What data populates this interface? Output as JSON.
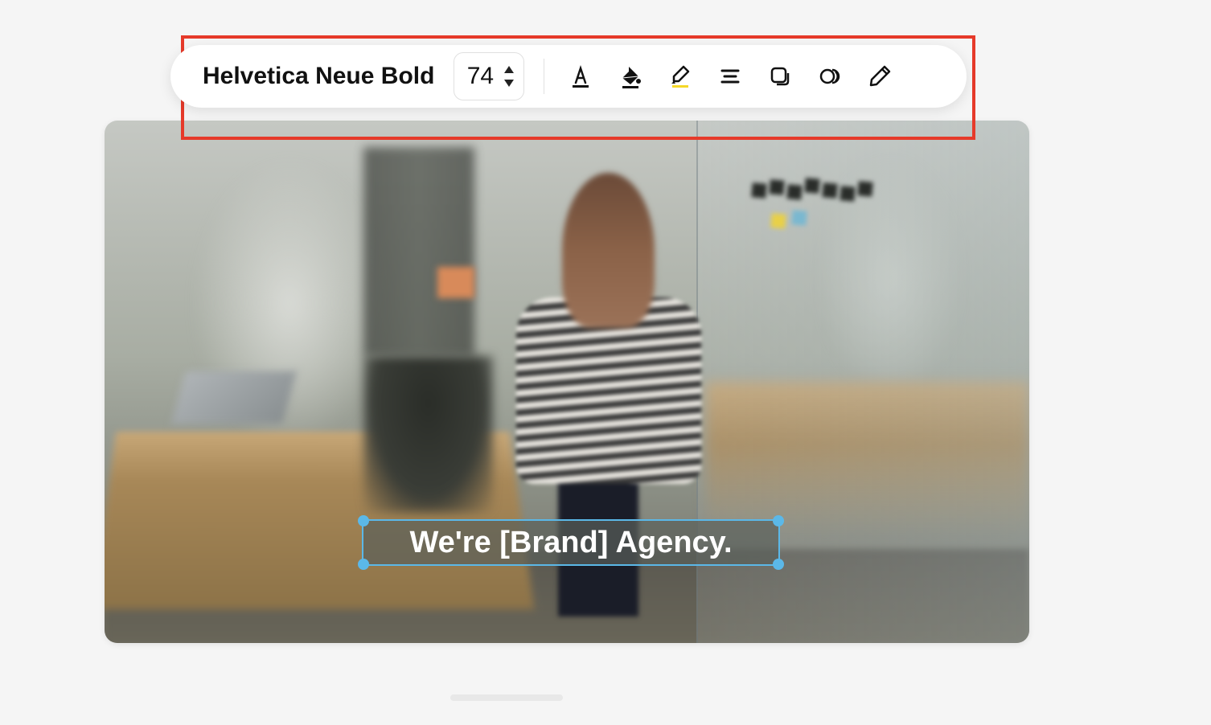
{
  "toolbar": {
    "font_name": "Helvetica Neue Bold",
    "font_size": "74",
    "tools": {
      "text_color": "text-color",
      "fill_color": "fill-color",
      "highlight": "highlight",
      "align": "align",
      "layers": "layers",
      "effects": "effects",
      "edit": "edit"
    }
  },
  "canvas": {
    "text_element": {
      "content": "We're [Brand] Agency.",
      "selected": true
    }
  },
  "colors": {
    "selection": "#5bb8e8",
    "highlight_box": "#e63a2a",
    "highlight_underline": "#f5d828"
  }
}
